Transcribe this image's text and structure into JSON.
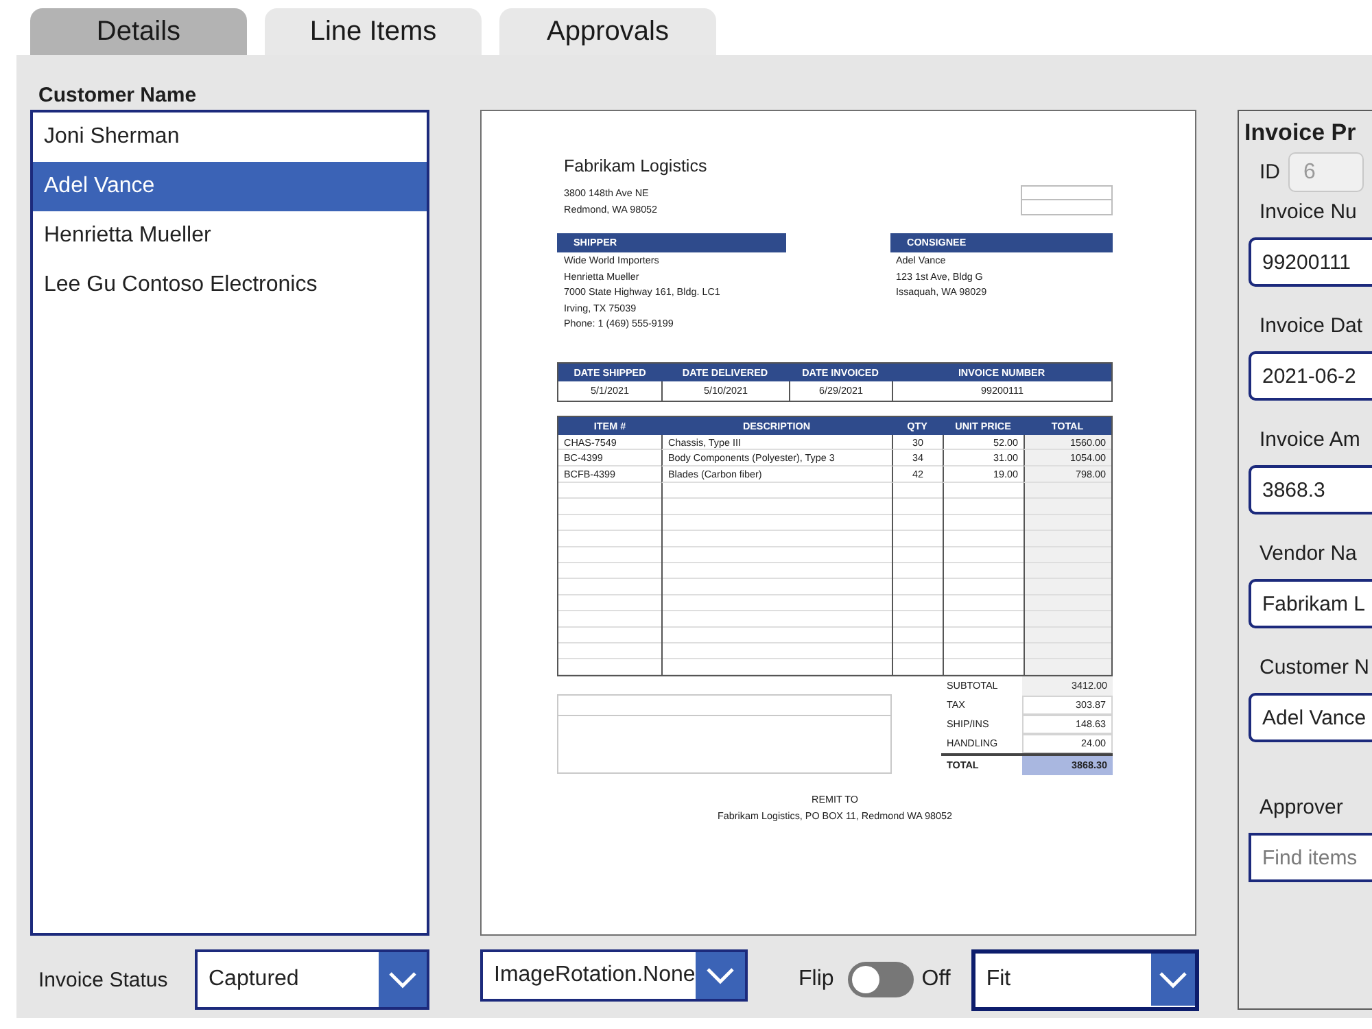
{
  "tabs": [
    {
      "label": "Details",
      "selected": true
    },
    {
      "label": "Line Items",
      "selected": false
    },
    {
      "label": "Approvals",
      "selected": false
    }
  ],
  "customer_list": {
    "label": "Customer Name",
    "items": [
      {
        "name": "Joni Sherman",
        "selected": false
      },
      {
        "name": "Adel Vance",
        "selected": true
      },
      {
        "name": "Henrietta Mueller",
        "selected": false
      },
      {
        "name": "Lee Gu Contoso Electronics",
        "selected": false
      }
    ]
  },
  "document": {
    "company": "Fabrikam Logistics",
    "address": [
      "3800 148th Ave NE",
      "Redmond, WA 98052"
    ],
    "shipper": {
      "heading": "SHIPPER",
      "lines": [
        "Wide World Importers",
        "Henrietta Mueller",
        "7000 State Highway 161, Bldg. LC1",
        "Irving, TX 75039",
        "Phone: 1 (469) 555-9199"
      ]
    },
    "consignee": {
      "heading": "CONSIGNEE",
      "lines": [
        "Adel Vance",
        "123 1st Ave, Bldg G",
        "Issaquah, WA 98029"
      ]
    },
    "dates_table": {
      "columns": [
        "DATE SHIPPED",
        "DATE DELIVERED",
        "DATE INVOICED",
        "INVOICE NUMBER"
      ],
      "values": [
        "5/1/2021",
        "5/10/2021",
        "6/29/2021",
        "99200111"
      ]
    },
    "items_table": {
      "columns": [
        "ITEM #",
        "DESCRIPTION",
        "QTY",
        "UNIT PRICE",
        "TOTAL"
      ],
      "rows": [
        [
          "CHAS-7549",
          "Chassis, Type III",
          "30",
          "52.00",
          "1560.00"
        ],
        [
          "BC-4399",
          "Body Components (Polyester), Type 3",
          "34",
          "31.00",
          "1054.00"
        ],
        [
          "BCFB-4399",
          "Blades (Carbon fiber)",
          "42",
          "19.00",
          "798.00"
        ]
      ]
    },
    "totals": [
      {
        "kind": "subtotal",
        "label": "SUBTOTAL",
        "value": "3412.00"
      },
      {
        "kind": "charge",
        "label": "TAX",
        "value": "303.87"
      },
      {
        "kind": "charge",
        "label": "SHIP/INS",
        "value": "148.63"
      },
      {
        "kind": "charge",
        "label": "HANDLING",
        "value": "24.00"
      },
      {
        "kind": "total",
        "label": "TOTAL",
        "value": "3868.30"
      }
    ],
    "remit": {
      "heading": "REMIT TO",
      "address": "Fabrikam Logistics, PO BOX 11, Redmond WA 98052"
    }
  },
  "details_panel": {
    "title": "Invoice Pr",
    "id_field": {
      "label": "ID",
      "value": "6",
      "disabled": true
    },
    "fields": [
      {
        "kind": "text",
        "label": "Invoice Nu",
        "value": "99200111"
      },
      {
        "kind": "text",
        "label": "Invoice Dat",
        "value": "2021-06-2"
      },
      {
        "kind": "text",
        "label": "Invoice Am",
        "value": "3868.3"
      },
      {
        "kind": "text",
        "label": "Vendor Na",
        "value": "Fabrikam L"
      },
      {
        "kind": "text",
        "label": "Customer N",
        "value": "Adel Vance"
      },
      {
        "kind": "search",
        "label": "Approver",
        "placeholder": "Find items"
      }
    ]
  },
  "bottom_bar": {
    "status": {
      "label": "Invoice Status",
      "value": "Captured"
    },
    "rotation": {
      "value": "ImageRotation.None"
    },
    "flip": {
      "label": "Flip",
      "on": false,
      "state_text": "Off"
    },
    "fit": {
      "value": "Fit",
      "focused": true
    }
  }
}
